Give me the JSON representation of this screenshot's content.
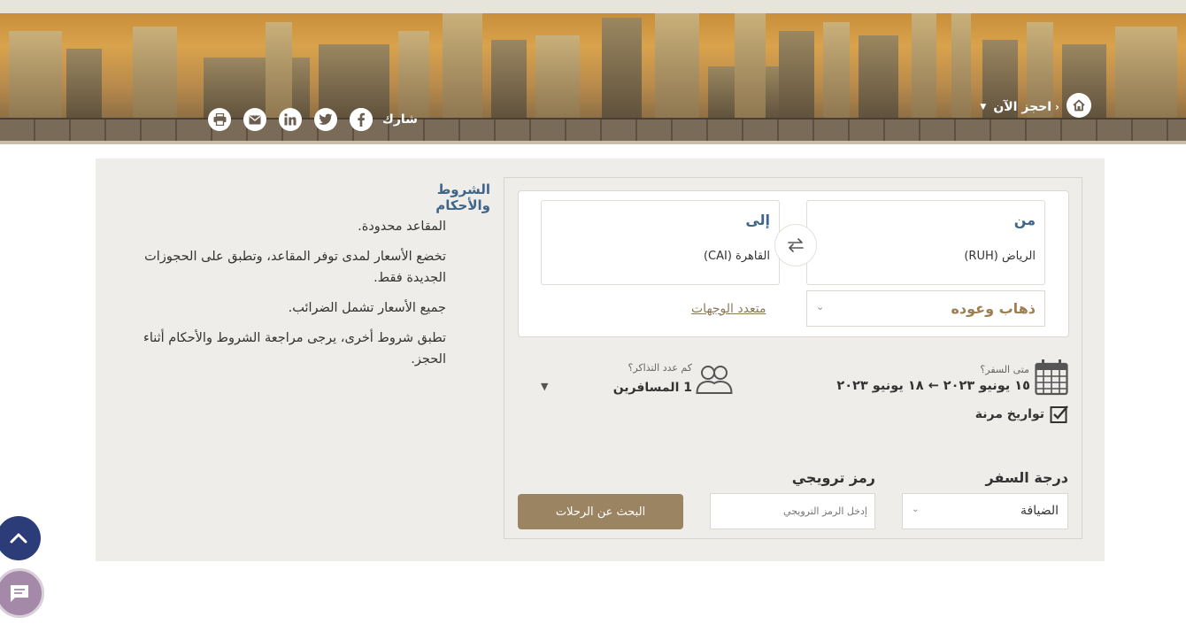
{
  "header": {
    "breadcrumb_label": "احجز الآن",
    "share_label": "شارك",
    "social_icons": [
      "facebook-icon",
      "twitter-icon",
      "linkedin-icon",
      "mail-icon",
      "print-icon"
    ]
  },
  "terms": {
    "title": "الشروط والأحكام",
    "items": [
      "المقاعد محدودة.",
      "تخضع الأسعار لمدى توفر المقاعد، وتطبق على الحجوزات الجديدة فقط.",
      "جميع الأسعار تشمل الضرائب.",
      "تطبق شروط أخرى، يرجى مراجعة الشروط والأحكام أثناء الحجز."
    ]
  },
  "booking": {
    "from": {
      "label": "من",
      "value": "الرياض (RUH)"
    },
    "to": {
      "label": "إلى",
      "value": "القاهرة (CAI)"
    },
    "trip_type": "ذهاب وعوده",
    "multi_city_link": "متعدد الوجهات",
    "when": {
      "label": "متى السفر؟",
      "value": "١٥ يونيو ٢٠٢٣  ←  ١٨ يونيو ٢٠٢٣"
    },
    "flexible_dates": {
      "label": "تواريخ مرنة",
      "checked": true
    },
    "passengers": {
      "label": "كم عدد التذاكر؟",
      "value": "1 المسافرين"
    },
    "cabin": {
      "title": "درجة السفر",
      "value": "الضيافة"
    },
    "promo": {
      "title": "رمز ترويجي",
      "placeholder": "إدخل الرمز الترويجي"
    },
    "search_button": "البحث عن الرحلات"
  },
  "colors": {
    "accent": "#9b8462",
    "title_blue": "#3f6589",
    "fab_navy": "#2b3c79",
    "fab_chat": "#a489a9"
  }
}
